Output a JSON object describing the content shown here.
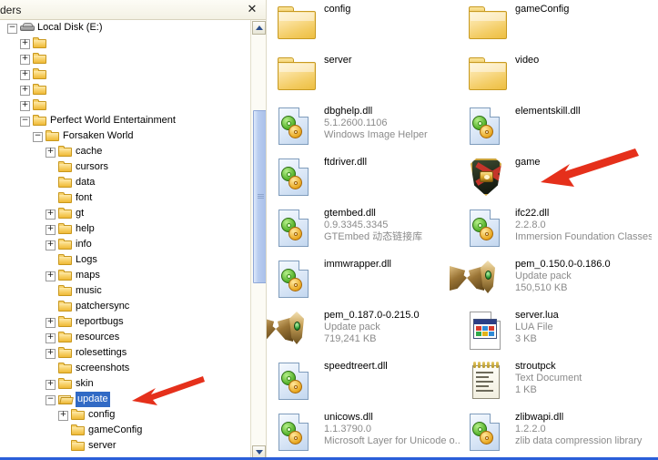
{
  "window": {
    "folders_title": "ders",
    "close_label": "✕"
  },
  "tree": {
    "root": {
      "label": "Local Disk (E:)",
      "icon": "drive-icon",
      "expander": "−"
    },
    "items": [
      {
        "label": "",
        "indent": 1,
        "expander": "+",
        "icon": "folder-icon"
      },
      {
        "label": "",
        "indent": 1,
        "expander": "+",
        "icon": "folder-icon"
      },
      {
        "label": "",
        "indent": 1,
        "expander": "+",
        "icon": "folder-icon"
      },
      {
        "label": "",
        "indent": 1,
        "expander": "+",
        "icon": "folder-icon"
      },
      {
        "label": "",
        "indent": 1,
        "expander": "+",
        "icon": "folder-icon"
      },
      {
        "label": "Perfect World Entertainment",
        "indent": 1,
        "expander": "−",
        "icon": "folder-icon"
      },
      {
        "label": "Forsaken World",
        "indent": 2,
        "expander": "−",
        "icon": "folder-icon"
      },
      {
        "label": "cache",
        "indent": 3,
        "expander": "+",
        "icon": "folder-icon"
      },
      {
        "label": "cursors",
        "indent": 3,
        "expander": "",
        "icon": "folder-icon"
      },
      {
        "label": "data",
        "indent": 3,
        "expander": "",
        "icon": "folder-icon"
      },
      {
        "label": "font",
        "indent": 3,
        "expander": "",
        "icon": "folder-icon"
      },
      {
        "label": "gt",
        "indent": 3,
        "expander": "+",
        "icon": "folder-icon"
      },
      {
        "label": "help",
        "indent": 3,
        "expander": "+",
        "icon": "folder-icon"
      },
      {
        "label": "info",
        "indent": 3,
        "expander": "+",
        "icon": "folder-icon"
      },
      {
        "label": "Logs",
        "indent": 3,
        "expander": "",
        "icon": "folder-icon"
      },
      {
        "label": "maps",
        "indent": 3,
        "expander": "+",
        "icon": "folder-icon"
      },
      {
        "label": "music",
        "indent": 3,
        "expander": "",
        "icon": "folder-icon"
      },
      {
        "label": "patchersync",
        "indent": 3,
        "expander": "",
        "icon": "folder-icon"
      },
      {
        "label": "reportbugs",
        "indent": 3,
        "expander": "+",
        "icon": "folder-icon"
      },
      {
        "label": "resources",
        "indent": 3,
        "expander": "+",
        "icon": "folder-icon"
      },
      {
        "label": "rolesettings",
        "indent": 3,
        "expander": "+",
        "icon": "folder-icon"
      },
      {
        "label": "screenshots",
        "indent": 3,
        "expander": "",
        "icon": "folder-icon"
      },
      {
        "label": "skin",
        "indent": 3,
        "expander": "+",
        "icon": "folder-icon"
      },
      {
        "label": "update",
        "indent": 3,
        "expander": "−",
        "icon": "folder-open-icon",
        "selected": true
      },
      {
        "label": "config",
        "indent": 4,
        "expander": "+",
        "icon": "folder-icon"
      },
      {
        "label": "gameConfig",
        "indent": 4,
        "expander": "",
        "icon": "folder-icon"
      },
      {
        "label": "server",
        "indent": 4,
        "expander": "",
        "icon": "folder-icon"
      }
    ],
    "selection_color": "#316ac5"
  },
  "files": {
    "column_left": [
      {
        "name": "config",
        "icon": "folder-icon",
        "meta1": "",
        "meta2": ""
      },
      {
        "name": "server",
        "icon": "folder-icon",
        "meta1": "",
        "meta2": ""
      },
      {
        "name": "dbghelp.dll",
        "icon": "dll-icon",
        "meta1": "5.1.2600.1106",
        "meta2": "Windows Image Helper"
      },
      {
        "name": "ftdriver.dll",
        "icon": "dll-icon",
        "meta1": "",
        "meta2": ""
      },
      {
        "name": "gtembed.dll",
        "icon": "dll-icon",
        "meta1": "0.9.3345.3345",
        "meta2": "GTEmbed 动态链接库"
      },
      {
        "name": "immwrapper.dll",
        "icon": "dll-icon",
        "meta1": "",
        "meta2": ""
      },
      {
        "name": "pem_0.187.0-0.215.0",
        "icon": "update-pack-icon",
        "meta1": "Update pack",
        "meta2": "719,241 KB"
      },
      {
        "name": "speedtreert.dll",
        "icon": "dll-icon",
        "meta1": "",
        "meta2": ""
      },
      {
        "name": "unicows.dll",
        "icon": "dll-icon",
        "meta1": "1.1.3790.0",
        "meta2": "Microsoft Layer for Unicode o..."
      }
    ],
    "column_right": [
      {
        "name": "gameConfig",
        "icon": "folder-icon",
        "meta1": "",
        "meta2": ""
      },
      {
        "name": "video",
        "icon": "folder-icon",
        "meta1": "",
        "meta2": ""
      },
      {
        "name": "elementskill.dll",
        "icon": "dll-icon",
        "meta1": "",
        "meta2": ""
      },
      {
        "name": "game",
        "icon": "game-shield-icon",
        "meta1": "",
        "meta2": ""
      },
      {
        "name": "ifc22.dll",
        "icon": "dll-icon",
        "meta1": "2.2.8.0",
        "meta2": "Immersion Foundation Classes"
      },
      {
        "name": "pem_0.150.0-0.186.0",
        "icon": "update-pack-icon",
        "meta1": "Update pack",
        "meta2": "150,510 KB"
      },
      {
        "name": "server.lua",
        "icon": "lua-file-icon",
        "meta1": "LUA File",
        "meta2": "3 KB"
      },
      {
        "name": "stroutpck",
        "icon": "text-document-icon",
        "meta1": "Text Document",
        "meta2": "1 KB"
      },
      {
        "name": "zlibwapi.dll",
        "icon": "dll-icon",
        "meta1": "1.2.2.0",
        "meta2": "zlib data compression library"
      }
    ]
  },
  "annotations": {
    "color": "#e5301b",
    "arrows": [
      {
        "target": "update",
        "pointing": "left"
      },
      {
        "target": "game",
        "pointing": "left"
      }
    ]
  },
  "scrollbar": {
    "up_glyph": "▲",
    "down_glyph": "▼"
  }
}
